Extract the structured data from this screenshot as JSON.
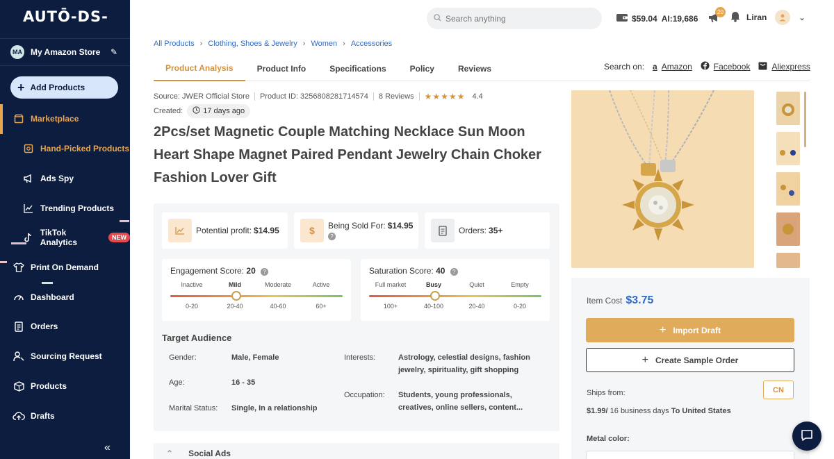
{
  "brand": {
    "logo_text": "AUTŌ-DS-"
  },
  "sidebar": {
    "store": {
      "initials": "MA",
      "name": "My Amazon Store"
    },
    "add_products_label": "Add Products",
    "items": [
      {
        "label": "Marketplace",
        "icon": "store-icon"
      },
      {
        "label": "Hand-Picked Products",
        "icon": "hand-picked-icon"
      },
      {
        "label": "Ads Spy",
        "icon": "megaphone-icon"
      },
      {
        "label": "Trending Products",
        "icon": "trending-chart-icon"
      },
      {
        "label": "TikTok Analytics",
        "icon": "tiktok-icon",
        "badge": "NEW"
      },
      {
        "label": "Print On Demand",
        "icon": "shirt-icon"
      },
      {
        "label": "Dashboard",
        "icon": "gauge-icon"
      },
      {
        "label": "Orders",
        "icon": "orders-icon"
      },
      {
        "label": "Sourcing Request",
        "icon": "sourcing-icon"
      },
      {
        "label": "Products",
        "icon": "box-icon"
      },
      {
        "label": "Drafts",
        "icon": "cloud-upload-icon"
      }
    ],
    "collapse_symbol": "«"
  },
  "topbar": {
    "search_placeholder": "Search anything",
    "balance": "$59.04",
    "ai_credits": "AI:19,686",
    "notification_count": "20",
    "user_name": "Liran"
  },
  "breadcrumb": [
    "All Products",
    "Clothing, Shoes & Jewelry",
    "Women",
    "Accessories"
  ],
  "tabs": [
    "Product Analysis",
    "Product Info",
    "Specifications",
    "Policy",
    "Reviews"
  ],
  "search_on": {
    "label": "Search on:",
    "links": [
      "Amazon",
      "Facebook",
      "Aliexpress"
    ]
  },
  "product": {
    "source": "Source: JWER Official Store",
    "product_id": "Product ID: 3256808281714574",
    "reviews": "8 Reviews",
    "stars": "★★★★★",
    "rating": "4.4",
    "created_label": "Created:",
    "created_age": "17 days ago",
    "title": "2Pcs/set Magnetic Couple Matching Necklace Sun Moon Heart Shape Magnet Paired Pendant Jewelry Chain Choker Fashion Lover Gift"
  },
  "stats": {
    "profit_label": "Potential profit:",
    "profit_value": "$14.95",
    "sold_label": "Being Sold For:",
    "sold_value": "$14.95",
    "orders_label": "Orders:",
    "orders_value": "35+"
  },
  "engagement": {
    "title": "Engagement Score:",
    "score": "20",
    "labels": [
      "Inactive",
      "Mild",
      "Moderate",
      "Active"
    ],
    "ranges": [
      "0-20",
      "20-40",
      "40-60",
      "60+"
    ],
    "selected_index": 1
  },
  "saturation": {
    "title": "Saturation Score:",
    "score": "40",
    "labels": [
      "Full market",
      "Busy",
      "Quiet",
      "Empty"
    ],
    "ranges": [
      "100+",
      "40-100",
      "20-40",
      "0-20"
    ],
    "selected_index": 1
  },
  "audience": {
    "title": "Target Audience",
    "gender_label": "Gender:",
    "gender": "Male, Female",
    "age_label": "Age:",
    "age": "16 - 35",
    "marital_label": "Marital Status:",
    "marital": "Single, In a relationship",
    "interests_label": "Interests:",
    "interests": "Astrology, celestial designs, fashion jewelry, spirituality, gift shopping",
    "occupation_label": "Occupation:",
    "occupation": "Students, young professionals, creatives, online sellers, content..."
  },
  "social_ads_label": "Social Ads",
  "purchase": {
    "item_cost_label": "Item Cost",
    "item_cost": "$3.75",
    "import_label": "Import Draft",
    "sample_label": "Create Sample Order",
    "ships_from_label": "Ships from:",
    "ships_from": "CN",
    "shipping_price": "$1.99/",
    "shipping_days": " 16 business days ",
    "shipping_dest": "To United States",
    "metal_color_label": "Metal color:"
  },
  "colors": {
    "sidebar_bg": "#0d1d3f",
    "accent": "#e0ab5a",
    "link": "#2f6bc6"
  }
}
